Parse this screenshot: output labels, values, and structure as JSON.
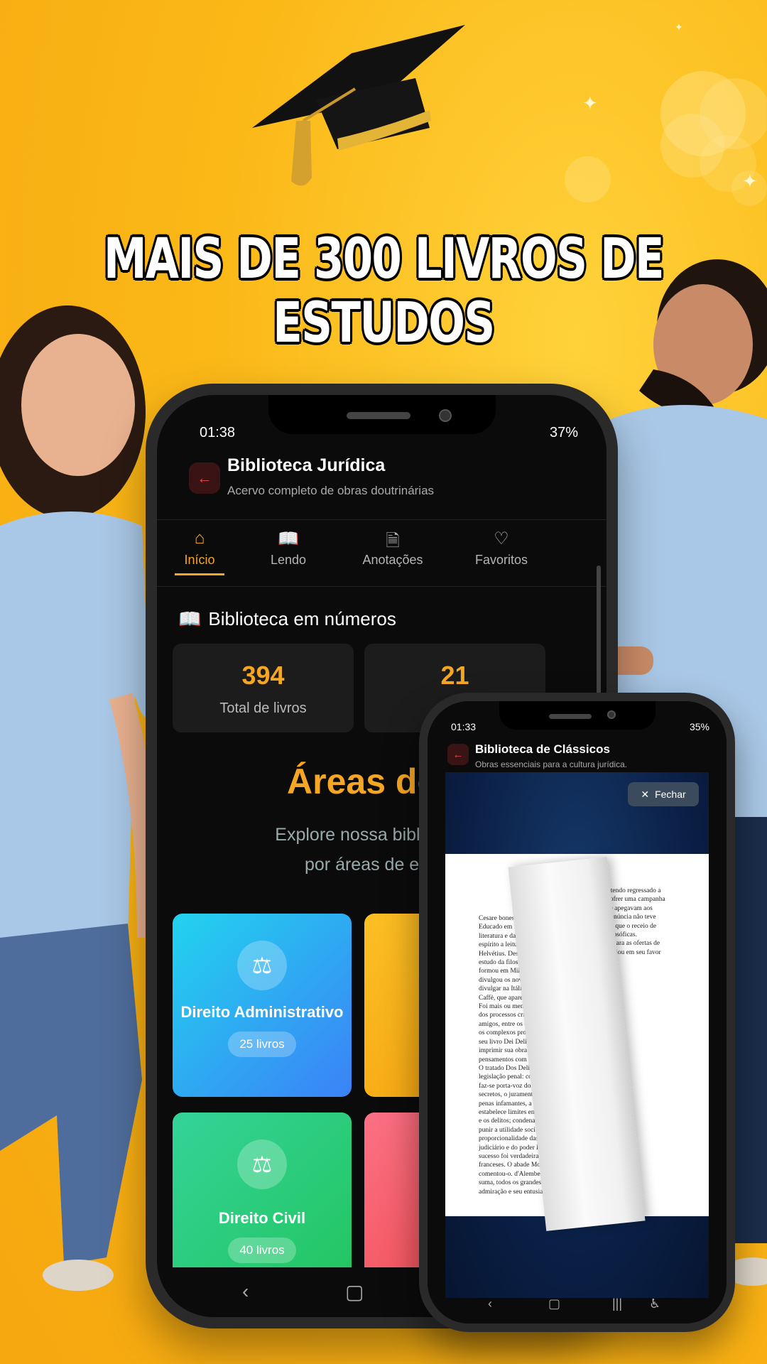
{
  "headline": "MAIS DE 300 LIVROS DE ESTUDOS",
  "colors": {
    "accent": "#f5a623",
    "background": "#fbb817"
  },
  "big_phone": {
    "status": {
      "time": "01:38",
      "battery": "37%"
    },
    "header": {
      "title": "Biblioteca Jurídica",
      "subtitle": "Acervo completo de obras doutrinárias"
    },
    "tabs": [
      {
        "label": "Início",
        "icon": "home-icon",
        "active": true
      },
      {
        "label": "Lendo",
        "icon": "book-icon"
      },
      {
        "label": "Anotações",
        "icon": "document-icon"
      },
      {
        "label": "Favoritos",
        "icon": "heart-icon"
      }
    ],
    "stats_title": "Biblioteca em números",
    "stats": [
      {
        "value": "394",
        "label": "Total de livros"
      },
      {
        "value": "21",
        "label": "Áre"
      }
    ],
    "areas_title": "Áreas do D",
    "areas_desc_1": "Explore nossa biblioteca ju",
    "areas_desc_2": "por áreas de espec",
    "cards": [
      {
        "name": "Direito Administrativo",
        "count": "25 livros",
        "icon": "scale-icon"
      },
      {
        "name": "Direito Civil",
        "count": "40 livros",
        "icon": "scale-icon"
      }
    ]
  },
  "small_phone": {
    "status": {
      "time": "01:33",
      "battery": "35%"
    },
    "header": {
      "title": "Biblioteca de Clássicos",
      "subtitle": "Obras essenciais para a cultura jurídica."
    },
    "close_label": "Fechar",
    "page_text_left": "Cesare bonesana,\nEducado em Paris pe\nliteratura e das mater\nespírito a leitura das\nHelvétius. Desde entã\nestudo da filosofia. Foi\nformou em Milão e c\ndivulgou os novos prin\ndivulgar na Itália as idéia\nCaffè, que apareceu de 17\nFoi mais ou menos por e\ndos processos criminais e\namigos, entre os quais se c\nos complexos problemas re\nseu livro Dei Delitti e delle\nimprimir sua obra secretame\npensamentos com expressões\nO tratado Dos Delitos e d\nlegislação penal: contra a tra\nfaz-se porta-voz dos protestos\nsecretos, o juramento imposto\npenas infamantes, a desigualdad\nestabelece limites entre a justiça\ne os delitos; condena o direito\npunir a utilidade social; declar\nproporcionalidade das penas ao\njudiciário e do poder legislativo.\nsucesso foi verdadeiramente extra\nfranceses. O abade Morellet tr\ncomentou-o. d'Alembert, Buffon, H\nsuma, todos os grandes homens da\nadmiração e seu entusiasmo. Em 17",
    "page_text_right": ", tendo regressado a\nsofrer uma campanha\nse apegavam aos\ndenúncia não teve\nna que o receio de\nfilosóficas.\ncusara as ofertas de\n, criou em seu favor"
  }
}
